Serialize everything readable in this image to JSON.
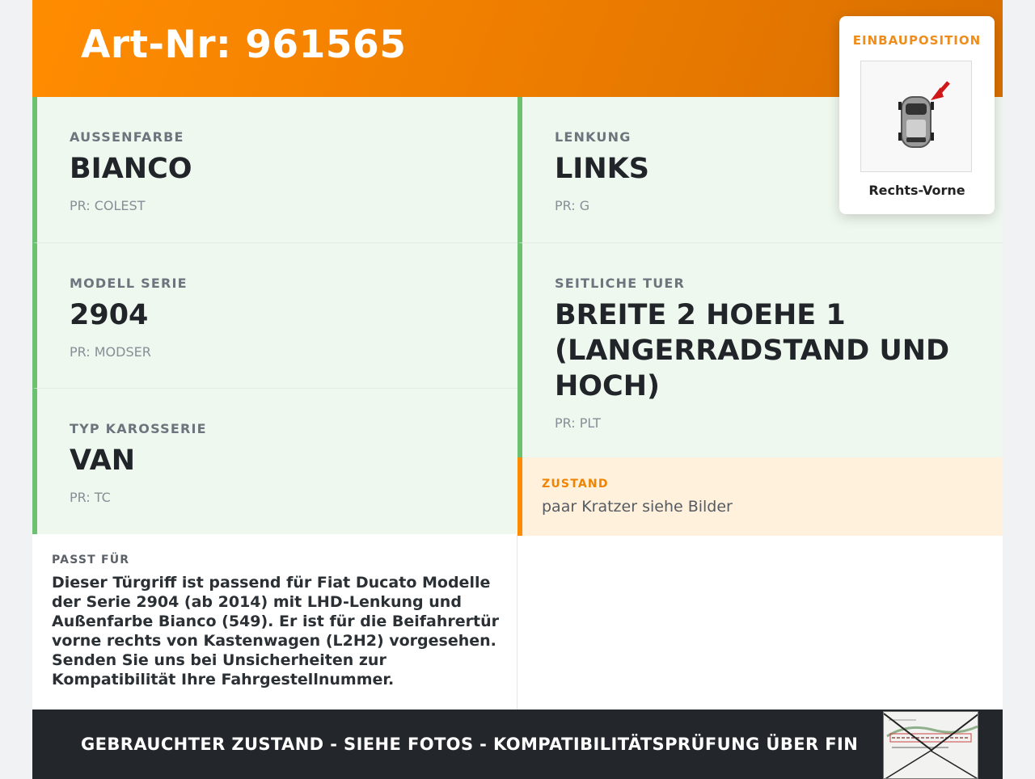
{
  "header": {
    "title": "Art-Nr: 961565"
  },
  "fields": [
    {
      "label": "AUSSENFARBE",
      "value": "BIANCO",
      "pr": "PR: COLEST"
    },
    {
      "label": "LENKUNG",
      "value": "LINKS",
      "pr": "PR: G"
    },
    {
      "label": "MODELL SERIE",
      "value": "2904",
      "pr": "PR: MODSER"
    },
    {
      "label": "SEITLICHE TUER",
      "value": "BREITE 2 HOEHE 1 (LANGERRADSTAND UND HOCH)",
      "pr": "PR: PLT"
    },
    {
      "label": "TYP KAROSSERIE",
      "value": "VAN",
      "pr": "PR: TC"
    }
  ],
  "zustand": {
    "label": "ZUSTAND",
    "text": "paar Kratzer siehe Bilder"
  },
  "passt": {
    "label": "PASST FÜR",
    "text": "Dieser Türgriff ist passend für Fiat Ducato Modelle der Serie 2904 (ab 2014) mit LHD-Lenkung und Außenfarbe Bianco (549). Er ist für die Beifahrertür vorne rechts von Kastenwagen (L2H2) vorgesehen. Senden Sie uns bei Unsicherheiten zur Kompatibilität Ihre Fahrgestellnummer."
  },
  "footer": {
    "text": "GEBRAUCHTER ZUSTAND - SIEHE FOTOS - KOMPATIBILITÄTSPRÜFUNG ÜBER FIN"
  },
  "einbau": {
    "label": "EINBAUPOSITION",
    "position": "Rechts-Vorne"
  },
  "colors": {
    "accent": "#ff8c00",
    "green_border": "#6cc06f",
    "cell_bg": "#eff8ef",
    "footer_bg": "#23272b"
  }
}
